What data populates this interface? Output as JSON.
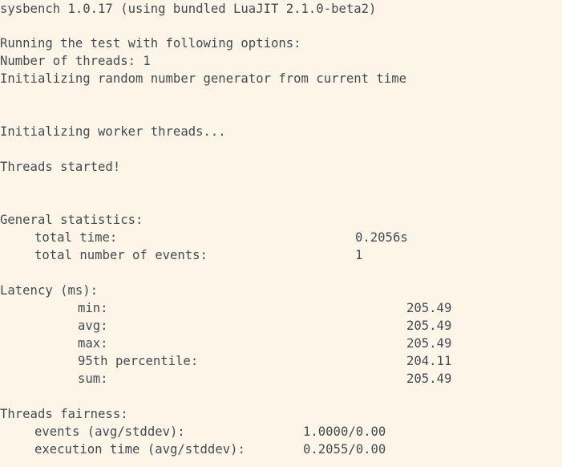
{
  "terminal": {
    "header": "sysbench 1.0.17 (using bundled LuaJIT 2.1.0-beta2)",
    "options_title": "Running the test with following options:",
    "threads_line": "Number of threads: 1",
    "rng_line": "Initializing random number generator from current time",
    "init_workers": "Initializing worker threads...",
    "threads_started": "Threads started!",
    "general": {
      "title": "General statistics:",
      "total_time_label": "total time:",
      "total_time_value": "0.2056s",
      "total_events_label": "total number of events:",
      "total_events_value": "1"
    },
    "latency": {
      "title": "Latency (ms):",
      "rows": [
        {
          "label": "min:",
          "value": "205.49"
        },
        {
          "label": "avg:",
          "value": "205.49"
        },
        {
          "label": "max:",
          "value": "205.49"
        },
        {
          "label": "95th percentile:",
          "value": "204.11"
        },
        {
          "label": "sum:",
          "value": "205.49"
        }
      ]
    },
    "fairness": {
      "title": "Threads fairness:",
      "events_label": "events (avg/stddev):",
      "events_value": "1.0000/0.00",
      "exec_label": "execution time (avg/stddev):",
      "exec_value": "0.2055/0.00"
    }
  }
}
